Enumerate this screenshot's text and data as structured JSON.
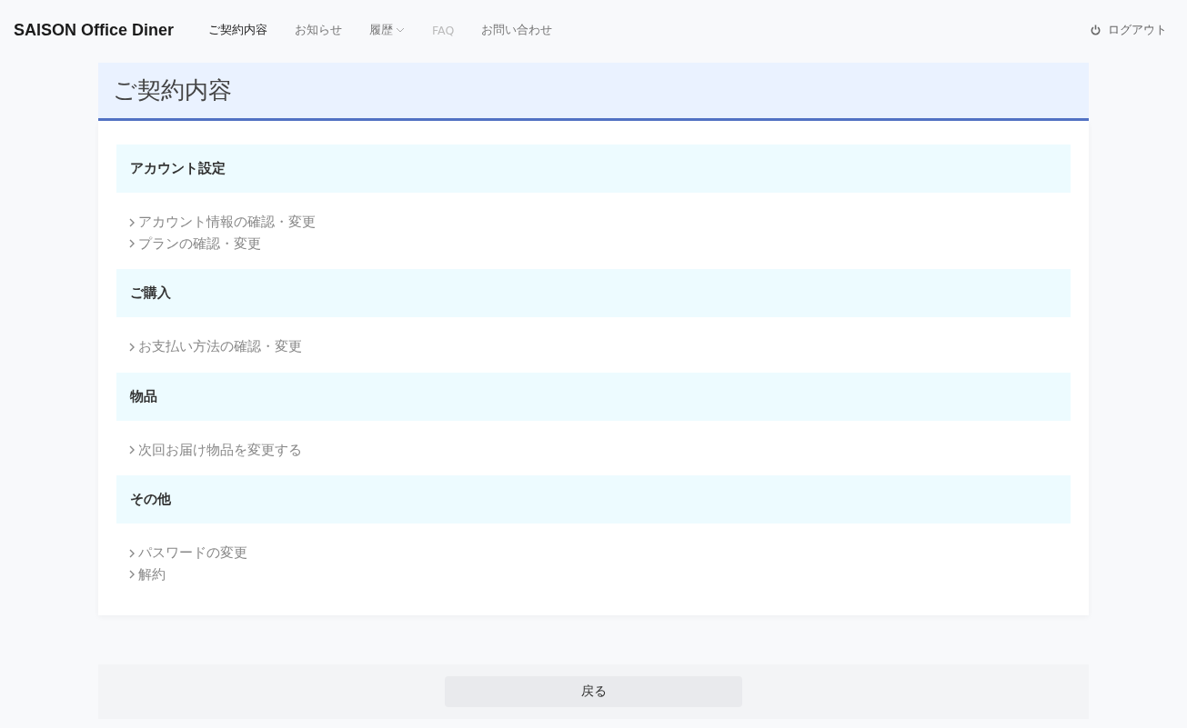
{
  "header": {
    "brand": "SAISON Office Diner",
    "nav": [
      {
        "label": "ご契約内容",
        "selected": true,
        "disabled": false,
        "dropdown": false
      },
      {
        "label": "お知らせ",
        "selected": false,
        "disabled": false,
        "dropdown": false
      },
      {
        "label": "履歴",
        "selected": false,
        "disabled": false,
        "dropdown": true
      },
      {
        "label": "FAQ",
        "selected": false,
        "disabled": true,
        "dropdown": false
      },
      {
        "label": "お問い合わせ",
        "selected": false,
        "disabled": false,
        "dropdown": false
      }
    ],
    "logout": "ログアウト"
  },
  "page_title": "ご契約内容",
  "sections": [
    {
      "heading": "アカウント設定",
      "links": [
        "アカウント情報の確認・変更",
        "プランの確認・変更"
      ]
    },
    {
      "heading": "ご購入",
      "links": [
        "お支払い方法の確認・変更"
      ]
    },
    {
      "heading": "物品",
      "links": [
        "次回お届け物品を変更する"
      ]
    },
    {
      "heading": "その他",
      "links": [
        "パスワードの変更",
        "解約"
      ]
    }
  ],
  "back_button": "戻る"
}
